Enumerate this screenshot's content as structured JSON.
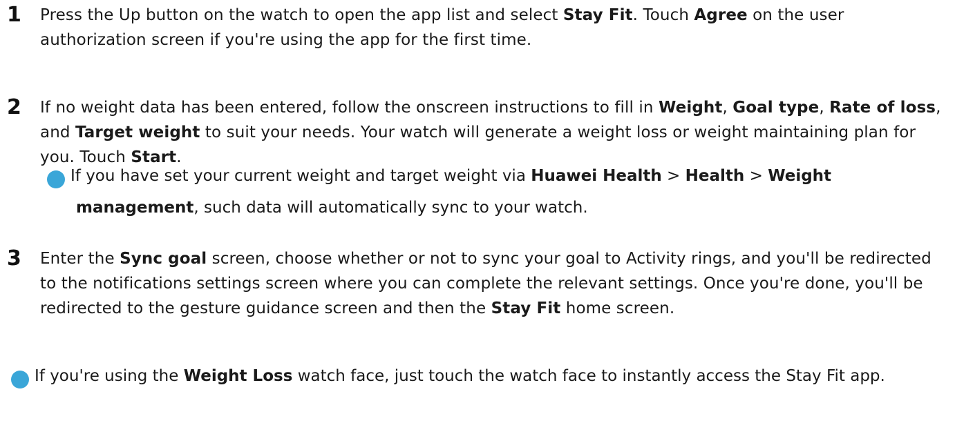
{
  "steps": [
    {
      "number": "1",
      "segments": [
        {
          "t": "Press the Up button on the watch to open the app list and select "
        },
        {
          "t": "Stay Fit",
          "b": true
        },
        {
          "t": ". Touch "
        },
        {
          "t": "Agree",
          "b": true
        },
        {
          "t": " on the user authorization screen if you're using the app for the first time."
        }
      ]
    },
    {
      "number": "2",
      "segments": [
        {
          "t": "If no weight data has been entered, follow the onscreen instructions to fill in "
        },
        {
          "t": "Weight",
          "b": true
        },
        {
          "t": ", "
        },
        {
          "t": "Goal type",
          "b": true
        },
        {
          "t": ", "
        },
        {
          "t": "Rate of loss",
          "b": true
        },
        {
          "t": ", and "
        },
        {
          "t": "Target weight",
          "b": true
        },
        {
          "t": " to suit your needs. Your watch will generate a weight loss or weight maintaining plan for you. Touch "
        },
        {
          "t": "Start",
          "b": true
        },
        {
          "t": "."
        }
      ]
    },
    {
      "number": "3",
      "segments": [
        {
          "t": "Enter the "
        },
        {
          "t": "Sync goal",
          "b": true
        },
        {
          "t": " screen, choose whether or not to sync your goal to Activity rings, and you'll be redirected to the notifications settings screen where you can complete the relevant settings. Once you're done, you'll be redirected to the gesture guidance screen and then the "
        },
        {
          "t": "Stay Fit",
          "b": true
        },
        {
          "t": " home screen."
        }
      ]
    }
  ],
  "notes": [
    {
      "icon": "info-icon",
      "segments": [
        {
          "t": "If you have set your current weight and target weight via "
        },
        {
          "t": "Huawei Health",
          "b": true
        },
        {
          "t": " > "
        },
        {
          "t": "Health",
          "b": true
        },
        {
          "t": " > "
        },
        {
          "t": "Weight management",
          "b": true
        },
        {
          "t": ", such data will automatically sync to your watch."
        }
      ]
    },
    {
      "icon": "info-icon",
      "segments": [
        {
          "t": "If you're using the "
        },
        {
          "t": "Weight Loss",
          "b": true
        },
        {
          "t": " watch face, just touch the watch face to instantly access the Stay Fit app."
        }
      ]
    }
  ],
  "icon_color": "#3aa6d8"
}
